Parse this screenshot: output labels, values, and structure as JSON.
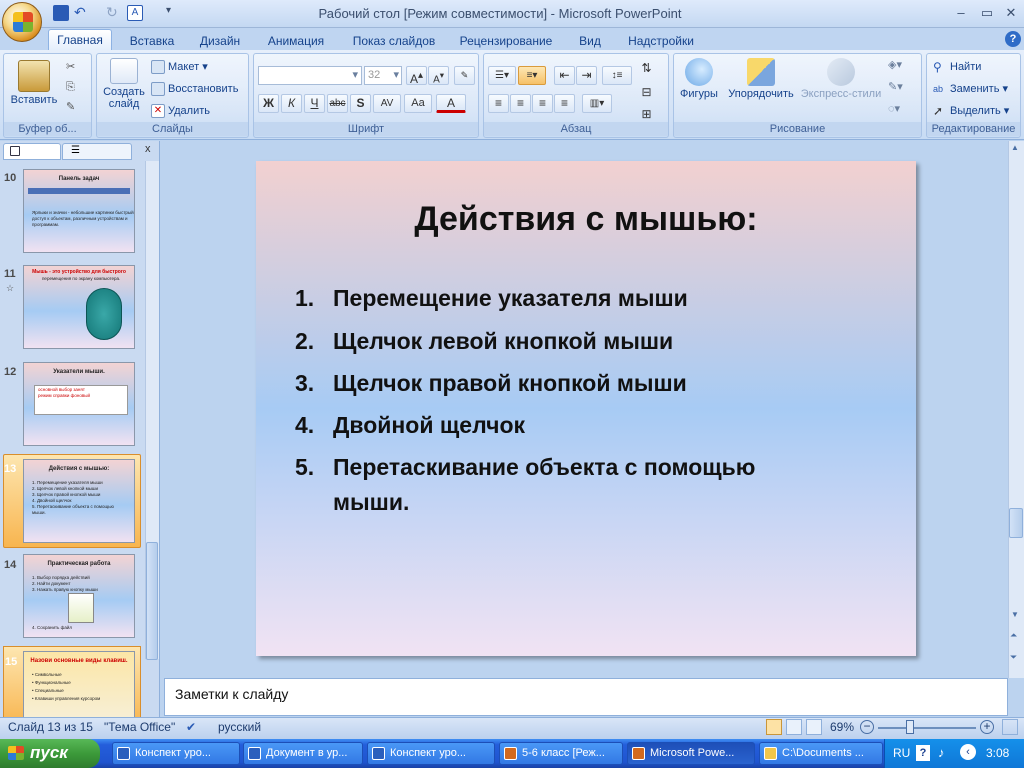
{
  "window": {
    "title": "Рабочий стол [Режим совместимости] - Microsoft PowerPoint",
    "controls": [
      "–",
      "▭",
      "✕"
    ]
  },
  "tabs": {
    "active": "Главная",
    "items": [
      "Вставка",
      "Дизайн",
      "Анимация",
      "Показ слайдов",
      "Рецензирование",
      "Вид",
      "Надстройки"
    ]
  },
  "ribbon": {
    "clipboard": {
      "paste": "Вставить",
      "label": "Буфер об..."
    },
    "slides": {
      "create": "Создать слайд",
      "layout": "Макет",
      "reset": "Восстановить",
      "delete": "Удалить",
      "label": "Слайды"
    },
    "font": {
      "size": "32",
      "label": "Шрифт",
      "bold": "Ж",
      "italic": "К",
      "underline": "Ч",
      "strike": "abc",
      "shadow": "S",
      "spacing": "AV",
      "case": "Aa",
      "color": "A"
    },
    "paragraph": {
      "label": "Абзац"
    },
    "drawing": {
      "shapes": "Фигуры",
      "arrange": "Упорядочить",
      "styles": "Экспресс-стили",
      "label": "Рисование"
    },
    "editing": {
      "find": "Найти",
      "replace": "Заменить",
      "select": "Выделить",
      "label": "Редактирование"
    }
  },
  "thumbnails": [
    {
      "num": "10",
      "title": "Панель задач",
      "lines": [
        "Ярлыки и значки - небольшие картинки быстрый",
        "доступ к объектам, различным устройствам и",
        "программам."
      ]
    },
    {
      "num": "11",
      "title": "Мышь - это устройство  для быстрого",
      "lines": [
        "перемещения по экрану компьютера."
      ]
    },
    {
      "num": "12",
      "title": "Указатели мыши.",
      "lines": [
        "основной  выбор  занят",
        "режим      справки   фоновый"
      ]
    },
    {
      "num": "13",
      "title": "Действия с мышью:",
      "lines": [
        "1. Перемещение указателя мыши",
        "2. Щелчок левой кнопкой мыши",
        "3. Щелчок правой кнопкой мыши",
        "4. Двойной щелчок",
        "5. Перетаскивание объекта с помощью",
        "    мыши."
      ]
    },
    {
      "num": "14",
      "title": "Практическая работа",
      "lines": [
        "1. Выбор порядка действий",
        "2. Найти документ",
        "3. Нажать правую кнопку мыши",
        "",
        "",
        "",
        "4. Сохранить файл"
      ]
    },
    {
      "num": "15",
      "title": "Назови основные виды клавиш.",
      "lines": [
        "• Символьные",
        "• Функциональные",
        "• Специальные",
        "• Клавиши управления курсором"
      ]
    }
  ],
  "slide": {
    "title": "Действия с мышью:",
    "items": [
      {
        "n": "1.",
        "text": "Перемещение указателя мыши"
      },
      {
        "n": "2.",
        "text": "Щелчок левой кнопкой мыши"
      },
      {
        "n": "3.",
        "text": "Щелчок правой кнопкой мыши"
      },
      {
        "n": "4.",
        "text": "Двойной щелчок"
      },
      {
        "n": "5.",
        "text": "Перетаскивание объекта с помощью"
      }
    ],
    "item5_cont": "мыши."
  },
  "notes": {
    "placeholder": "Заметки к слайду"
  },
  "status": {
    "slide": "Слайд 13 из 15",
    "theme": "\"Тема Office\"",
    "lang": "русский",
    "zoom": "69%"
  },
  "taskbar": {
    "start": "пуск",
    "tasks": [
      "Конспект уро...",
      "Документ в ур...",
      "Конспект уро...",
      "5-6 класс [Реж...",
      "Microsoft Powe...",
      "C:\\Documents ..."
    ],
    "lang": "RU",
    "clock": "3:08"
  }
}
